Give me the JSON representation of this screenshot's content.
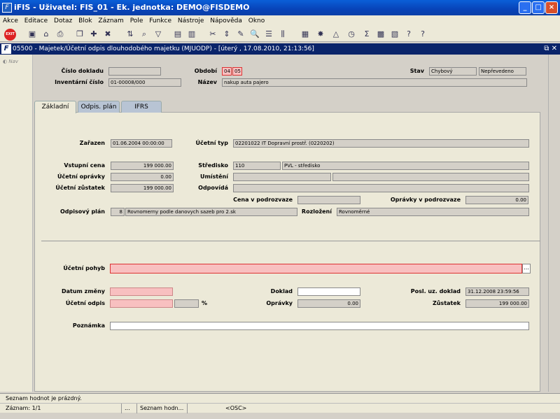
{
  "window": {
    "title": "iFIS - Uživatel: FIS_01 - Ek. jednotka: DEMO@FISDEMO",
    "app_icon": "F"
  },
  "menu": [
    "Akce",
    "Editace",
    "Dotaz",
    "Blok",
    "Záznam",
    "Pole",
    "Funkce",
    "Nástroje",
    "Nápověda",
    "Okno"
  ],
  "toolbar": {
    "exit_label": "EXIT"
  },
  "subwindow": {
    "title": "05500 - Majetek/Účetní odpis dlouhodobého majetku (MJUODP) - [úterý , 17.08.2010, 21:13:56]"
  },
  "nav": {
    "label": "Nav"
  },
  "header": {
    "cislo_dokladu_label": "Číslo dokladu",
    "cislo_dokladu": "",
    "obdobi_label": "Období",
    "obdobi_month": "04",
    "obdobi_year": "05",
    "stav_label": "Stav",
    "stav1": "Chybový",
    "stav2": "Nepřevedeno",
    "inventarni_label": "Inventární číslo",
    "inventarni": "01-00008/000",
    "nazev_label": "Název",
    "nazev": "nakup auta pajero"
  },
  "tabs": [
    "Základní",
    "Odpis. plán",
    "IFRS"
  ],
  "basic": {
    "zarazen_label": "Zařazen",
    "zarazen": "01.06.2004 00:00:00",
    "ucetni_typ_label": "Účetní typ",
    "ucetni_typ": "02201022 IT Dopravní prostř. (0220202)",
    "vstupni_cena_label": "Vstupní cena",
    "vstupni_cena": "199 000.00",
    "stredisko_label": "Středisko",
    "stredisko_code": "110",
    "stredisko_name": "PVL - středisko",
    "ucetni_opravky_label": "Účetní oprávky",
    "ucetni_opravky": "0.00",
    "umisteni_label": "Umístění",
    "ucetni_zustatek_label": "Účetní zůstatek",
    "ucetni_zustatek": "199 000.00",
    "odpovida_label": "Odpovídá",
    "cena_podrozvaze_label": "Cena v podrozvaze",
    "cena_podrozvaze": "",
    "opravky_podrozvaze_label": "Oprávky v podrozvaze",
    "opravky_podrozvaze": "0.00",
    "odpisovy_plan_label": "Odpisový plán",
    "odpisovy_plan_code": "8",
    "odpisovy_plan_name": "Rovnomerny podle danovych sazeb pro 2.sk",
    "rozlozeni_label": "Rozložení",
    "rozlozeni": "Rovnoměrné"
  },
  "movement": {
    "ucetni_pohyb_label": "Účetní pohyb",
    "ucetni_pohyb": "",
    "lov_button": "...",
    "datum_zmeny_label": "Datum změny",
    "datum_zmeny": "",
    "doklad_label": "Doklad",
    "doklad": "",
    "posl_doklad_label": "Posl. uz. doklad",
    "posl_doklad": "31.12.2008 23:59:56",
    "ucetni_odpis_label": "Účetní odpis",
    "ucetni_odpis": "",
    "ucetni_odpis_pct": "",
    "pct_sign": "%",
    "opravky_label": "Oprávky",
    "opravky": "0.00",
    "zustatek_label": "Zůstatek",
    "zustatek": "199 000.00",
    "poznamka_label": "Poznámka",
    "poznamka": ""
  },
  "status": {
    "message": "Seznam hodnot je prázdný.",
    "record": "Záznam: 1/1",
    "ellipsis": "...",
    "lov": "Seznam hodn...",
    "osc": "<OSC>"
  }
}
